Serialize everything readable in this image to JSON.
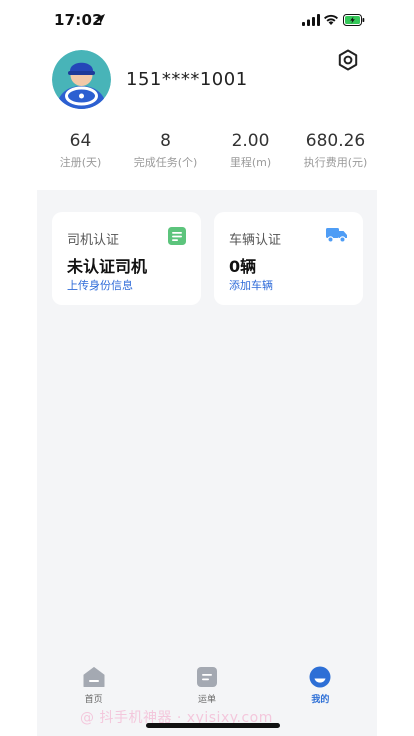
{
  "status_bar": {
    "time": "17:02"
  },
  "profile": {
    "phone": "151****1001"
  },
  "stats": [
    {
      "value": "64",
      "label": "注册(天)"
    },
    {
      "value": "8",
      "label": "完成任务(个)"
    },
    {
      "value": "2.00",
      "label": "里程(m)"
    },
    {
      "value": "680.26",
      "label": "执行费用(元)"
    }
  ],
  "cards": {
    "driver": {
      "title": "司机认证",
      "main": "未认证司机",
      "link": "上传身份信息",
      "icon": "document-icon",
      "icon_color": "#5cc47c"
    },
    "vehicle": {
      "title": "车辆认证",
      "main": "0辆",
      "link": "添加车辆",
      "icon": "truck-icon",
      "icon_color": "#4f9df5"
    }
  },
  "tabbar": {
    "items": [
      {
        "label": "首页",
        "icon": "home-icon",
        "active": false
      },
      {
        "label": "运单",
        "icon": "waybill-icon",
        "active": false
      },
      {
        "label": "我的",
        "icon": "profile-icon",
        "active": true
      }
    ]
  },
  "watermark": "@ 抖手机神器 · xyisixy.com",
  "colors": {
    "accent": "#2d6fd6",
    "link": "#2f6bd8",
    "background": "#f4f5f7"
  }
}
